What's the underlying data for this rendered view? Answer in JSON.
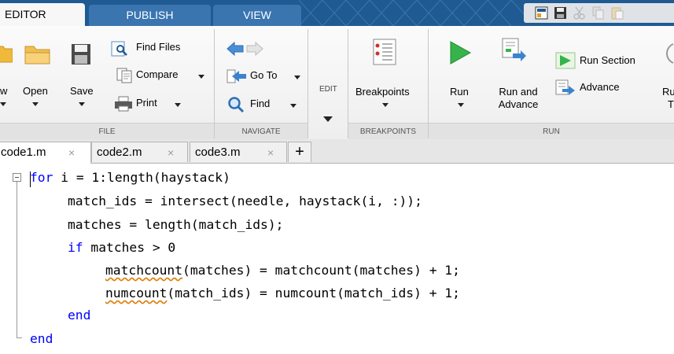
{
  "tabs": {
    "editor": "EDITOR",
    "publish": "PUBLISH",
    "view": "VIEW"
  },
  "file_section": {
    "new_label_partial": "w",
    "open_label": "Open",
    "save_label": "Save",
    "find_files_label": "Find Files",
    "compare_label": "Compare",
    "print_label": "Print",
    "section_label": "FILE"
  },
  "navigate_section": {
    "goto_label": "Go To",
    "find_label": "Find",
    "section_label": "NAVIGATE"
  },
  "edit_section": {
    "label": "EDIT"
  },
  "breakpoints_section": {
    "breakpoints_label": "Breakpoints",
    "section_label": "BREAKPOINTS"
  },
  "run_section": {
    "run_label": "Run",
    "run_advance_label_1": "Run and",
    "run_advance_label_2": "Advance",
    "run_section_label": "Run Section",
    "advance_label": "Advance",
    "run_time_partial_1": "Ru",
    "run_time_partial_2": "T",
    "section_label": "RUN"
  },
  "doc_tabs": [
    {
      "name": "code1.m",
      "active": true
    },
    {
      "name": "code2.m",
      "active": false
    },
    {
      "name": "code3.m",
      "active": false
    }
  ],
  "close_glyph": "×",
  "new_tab_glyph": "+",
  "code_lines": [
    {
      "kw": "for",
      "rest": " i = 1:length(haystack)"
    },
    {
      "text": "match_ids = intersect(needle, haystack(i, :));"
    },
    {
      "text": "matches = length(match_ids);"
    },
    {
      "kw": "if",
      "rest": " matches > 0"
    },
    {
      "sq": "matchcount",
      "rest": "(matches) = matchcount(matches) + 1;"
    },
    {
      "sq": "numcount",
      "rest": "(match_ids) = numcount(match_ids) + 1;"
    },
    {
      "kw": "end"
    },
    {
      "kw": "end"
    }
  ],
  "colors": {
    "tab_strip": "#1f5a93",
    "keyword": "#0000ff",
    "warning_squiggle": "#e07a00",
    "run_green": "#2fb24a"
  }
}
